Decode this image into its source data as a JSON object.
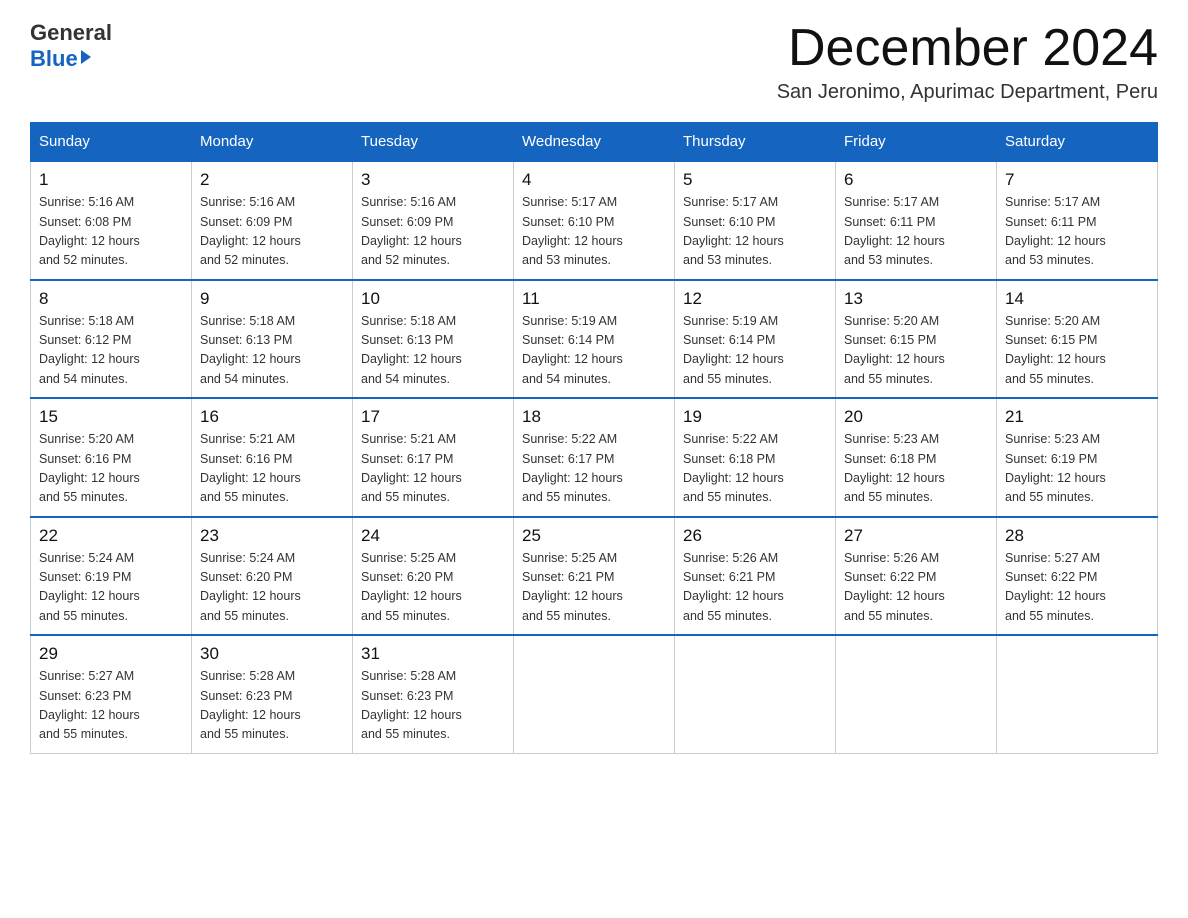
{
  "logo": {
    "general": "General",
    "blue": "Blue",
    "arrow": true
  },
  "title": "December 2024",
  "location": "San Jeronimo, Apurimac Department, Peru",
  "days_of_week": [
    "Sunday",
    "Monday",
    "Tuesday",
    "Wednesday",
    "Thursday",
    "Friday",
    "Saturday"
  ],
  "weeks": [
    [
      {
        "day": "1",
        "sunrise": "5:16 AM",
        "sunset": "6:08 PM",
        "daylight": "12 hours and 52 minutes."
      },
      {
        "day": "2",
        "sunrise": "5:16 AM",
        "sunset": "6:09 PM",
        "daylight": "12 hours and 52 minutes."
      },
      {
        "day": "3",
        "sunrise": "5:16 AM",
        "sunset": "6:09 PM",
        "daylight": "12 hours and 52 minutes."
      },
      {
        "day": "4",
        "sunrise": "5:17 AM",
        "sunset": "6:10 PM",
        "daylight": "12 hours and 53 minutes."
      },
      {
        "day": "5",
        "sunrise": "5:17 AM",
        "sunset": "6:10 PM",
        "daylight": "12 hours and 53 minutes."
      },
      {
        "day": "6",
        "sunrise": "5:17 AM",
        "sunset": "6:11 PM",
        "daylight": "12 hours and 53 minutes."
      },
      {
        "day": "7",
        "sunrise": "5:17 AM",
        "sunset": "6:11 PM",
        "daylight": "12 hours and 53 minutes."
      }
    ],
    [
      {
        "day": "8",
        "sunrise": "5:18 AM",
        "sunset": "6:12 PM",
        "daylight": "12 hours and 54 minutes."
      },
      {
        "day": "9",
        "sunrise": "5:18 AM",
        "sunset": "6:13 PM",
        "daylight": "12 hours and 54 minutes."
      },
      {
        "day": "10",
        "sunrise": "5:18 AM",
        "sunset": "6:13 PM",
        "daylight": "12 hours and 54 minutes."
      },
      {
        "day": "11",
        "sunrise": "5:19 AM",
        "sunset": "6:14 PM",
        "daylight": "12 hours and 54 minutes."
      },
      {
        "day": "12",
        "sunrise": "5:19 AM",
        "sunset": "6:14 PM",
        "daylight": "12 hours and 55 minutes."
      },
      {
        "day": "13",
        "sunrise": "5:20 AM",
        "sunset": "6:15 PM",
        "daylight": "12 hours and 55 minutes."
      },
      {
        "day": "14",
        "sunrise": "5:20 AM",
        "sunset": "6:15 PM",
        "daylight": "12 hours and 55 minutes."
      }
    ],
    [
      {
        "day": "15",
        "sunrise": "5:20 AM",
        "sunset": "6:16 PM",
        "daylight": "12 hours and 55 minutes."
      },
      {
        "day": "16",
        "sunrise": "5:21 AM",
        "sunset": "6:16 PM",
        "daylight": "12 hours and 55 minutes."
      },
      {
        "day": "17",
        "sunrise": "5:21 AM",
        "sunset": "6:17 PM",
        "daylight": "12 hours and 55 minutes."
      },
      {
        "day": "18",
        "sunrise": "5:22 AM",
        "sunset": "6:17 PM",
        "daylight": "12 hours and 55 minutes."
      },
      {
        "day": "19",
        "sunrise": "5:22 AM",
        "sunset": "6:18 PM",
        "daylight": "12 hours and 55 minutes."
      },
      {
        "day": "20",
        "sunrise": "5:23 AM",
        "sunset": "6:18 PM",
        "daylight": "12 hours and 55 minutes."
      },
      {
        "day": "21",
        "sunrise": "5:23 AM",
        "sunset": "6:19 PM",
        "daylight": "12 hours and 55 minutes."
      }
    ],
    [
      {
        "day": "22",
        "sunrise": "5:24 AM",
        "sunset": "6:19 PM",
        "daylight": "12 hours and 55 minutes."
      },
      {
        "day": "23",
        "sunrise": "5:24 AM",
        "sunset": "6:20 PM",
        "daylight": "12 hours and 55 minutes."
      },
      {
        "day": "24",
        "sunrise": "5:25 AM",
        "sunset": "6:20 PM",
        "daylight": "12 hours and 55 minutes."
      },
      {
        "day": "25",
        "sunrise": "5:25 AM",
        "sunset": "6:21 PM",
        "daylight": "12 hours and 55 minutes."
      },
      {
        "day": "26",
        "sunrise": "5:26 AM",
        "sunset": "6:21 PM",
        "daylight": "12 hours and 55 minutes."
      },
      {
        "day": "27",
        "sunrise": "5:26 AM",
        "sunset": "6:22 PM",
        "daylight": "12 hours and 55 minutes."
      },
      {
        "day": "28",
        "sunrise": "5:27 AM",
        "sunset": "6:22 PM",
        "daylight": "12 hours and 55 minutes."
      }
    ],
    [
      {
        "day": "29",
        "sunrise": "5:27 AM",
        "sunset": "6:23 PM",
        "daylight": "12 hours and 55 minutes."
      },
      {
        "day": "30",
        "sunrise": "5:28 AM",
        "sunset": "6:23 PM",
        "daylight": "12 hours and 55 minutes."
      },
      {
        "day": "31",
        "sunrise": "5:28 AM",
        "sunset": "6:23 PM",
        "daylight": "12 hours and 55 minutes."
      },
      null,
      null,
      null,
      null
    ]
  ],
  "labels": {
    "sunrise": "Sunrise:",
    "sunset": "Sunset:",
    "daylight": "Daylight:"
  }
}
